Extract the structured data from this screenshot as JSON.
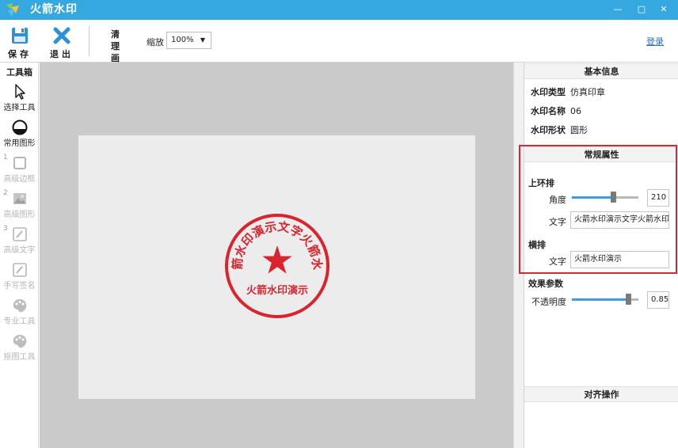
{
  "window": {
    "title": "火箭水印",
    "minimize": "—",
    "maximize": "□",
    "close": "✕"
  },
  "toolbar": {
    "save_label": "保存",
    "exit_label": "退出",
    "clear_label": "清理画布",
    "zoom_label": "缩放",
    "zoom_value": "100%",
    "login_label": "登录"
  },
  "toolbox": {
    "title": "工具箱",
    "items": [
      {
        "label": "选择工具",
        "icon": "cursor-icon",
        "enabled": true
      },
      {
        "label": "常用图形",
        "icon": "shape-icon",
        "enabled": true
      },
      {
        "label": "高级边框",
        "icon": "border-icon",
        "enabled": false,
        "num": "1"
      },
      {
        "label": "高级图形",
        "icon": "image-icon",
        "enabled": false,
        "num": "2"
      },
      {
        "label": "高级文字",
        "icon": "text-edit-icon",
        "enabled": false,
        "num": "3"
      },
      {
        "label": "手写签名",
        "icon": "signature-icon",
        "enabled": false
      },
      {
        "label": "专业工具",
        "icon": "palette-icon",
        "enabled": false
      },
      {
        "label": "抠图工具",
        "icon": "cutout-icon",
        "enabled": false
      }
    ]
  },
  "canvas": {
    "seal_top_text": "火箭水印演示文字火箭水印",
    "seal_bottom_text": "火箭水印演示",
    "seal_color": "#d9232d"
  },
  "panel": {
    "basic_info": {
      "title": "基本信息",
      "type_label": "水印类型",
      "type_value": "仿真印章",
      "name_label": "水印名称",
      "name_value": "06",
      "shape_label": "水印形状",
      "shape_value": "圆形"
    },
    "general": {
      "title": "常规属性",
      "top_ring_title": "上环排",
      "angle_label": "角度",
      "angle_value": "210",
      "angle_slider": 0.62,
      "top_text_label": "文字",
      "top_text_value": "火箭水印演示文字火箭水印",
      "horizontal_title": "横排",
      "horizontal_text_label": "文字",
      "horizontal_text_value": "火箭水印演示"
    },
    "effect": {
      "title": "效果参数",
      "opacity_label": "不透明度",
      "opacity_value": "0.85",
      "opacity_slider": 0.85
    },
    "align": {
      "title": "对齐操作"
    }
  },
  "colors": {
    "titlebar": "#35a8e0",
    "accent": "#3c9ee0",
    "highlight": "#d7282f"
  }
}
